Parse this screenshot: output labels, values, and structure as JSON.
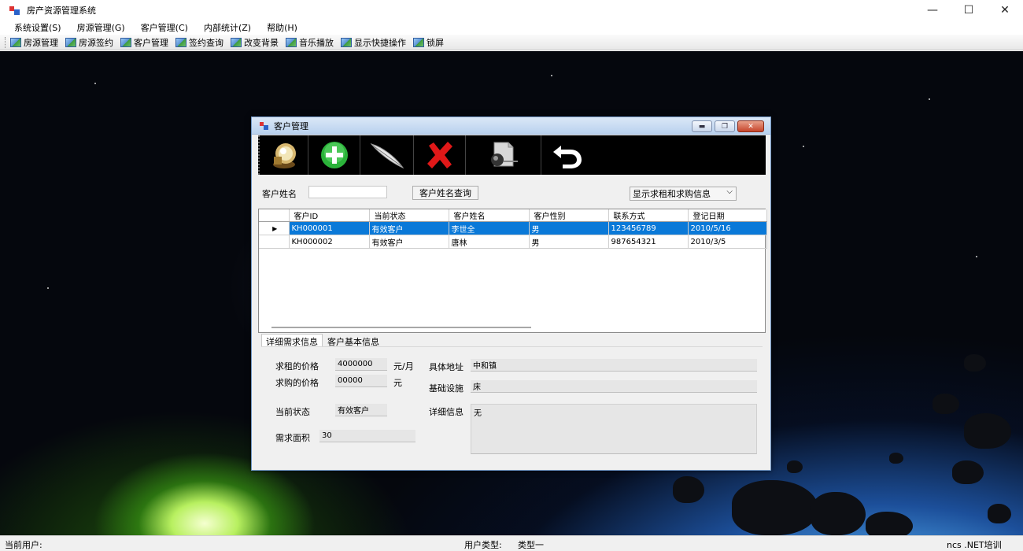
{
  "window": {
    "title": "房产资源管理系统",
    "minimize": "—",
    "maximize": "☐",
    "close": "✕"
  },
  "menu": [
    "系统设置(S)",
    "房源管理(G)",
    "客户管理(C)",
    "内部统计(Z)",
    "帮助(H)"
  ],
  "toolbar": [
    "房源管理",
    "房源签约",
    "客户管理",
    "签约查询",
    "改变背景",
    "音乐播放",
    "显示快捷操作",
    "锁屏"
  ],
  "child": {
    "title": "客户管理",
    "controls": {
      "minimize": "▬",
      "restore": "❐",
      "close": "✕"
    },
    "toolbar_icons": [
      "query-icon",
      "add-icon",
      "edit-icon",
      "delete-icon",
      "export-icon",
      "back-icon"
    ],
    "search": {
      "label": "客户姓名",
      "value": "",
      "button": "客户姓名查询"
    },
    "filter": {
      "selected": "显示求租和求购信息",
      "chevron": "⌵"
    },
    "grid": {
      "columns": [
        "客户ID",
        "当前状态",
        "客户姓名",
        "客户性别",
        "联系方式",
        "登记日期"
      ],
      "row_indicator": "▶",
      "rows": [
        [
          "KH000001",
          "有效客户",
          "李世全",
          "男",
          "123456789",
          "2010/5/16"
        ],
        [
          "KH000002",
          "有效客户",
          "唐林",
          "男",
          "987654321",
          "2010/3/5"
        ]
      ],
      "selected_row": 0
    },
    "tabs": [
      "详细需求信息",
      "客户基本信息"
    ],
    "details": {
      "rent_price_label": "求租的价格",
      "rent_price": "4000000",
      "rent_unit": "元/月",
      "buy_price_label": "求购的价格",
      "buy_price": "00000",
      "buy_unit": "元",
      "status_label": "当前状态",
      "status": "有效客户",
      "area_label": "需求面积",
      "area": "30",
      "address_label": "具体地址",
      "address": "中和镇",
      "facilities_label": "基础设施",
      "facilities": "床",
      "detail_label": "详细信息",
      "detail": "无"
    }
  },
  "status": {
    "current_user": "当前用户:",
    "user_type_label": "用户类型:",
    "user_type": "类型一",
    "credit": "ncs .NET培训"
  }
}
